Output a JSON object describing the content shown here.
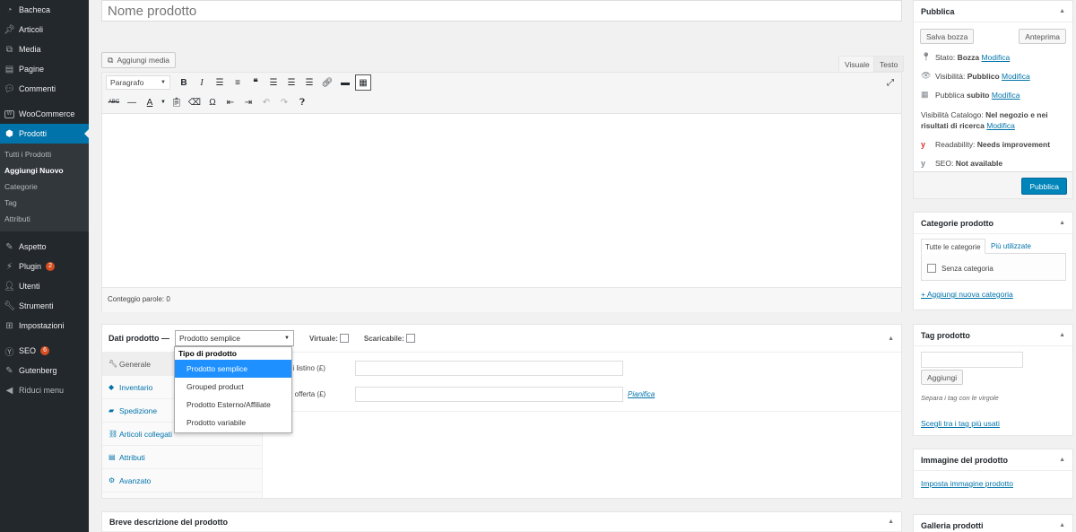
{
  "sidebar": {
    "items_top": [
      {
        "label": "Bacheca",
        "icon": "dashboard-icon"
      },
      {
        "label": "Articoli",
        "icon": "pin-icon"
      },
      {
        "label": "Media",
        "icon": "media-icon"
      },
      {
        "label": "Pagine",
        "icon": "page-icon"
      },
      {
        "label": "Commenti",
        "icon": "comment-icon"
      }
    ],
    "woocommerce": "WooCommerce",
    "prodotti": "Prodotti",
    "submenu": [
      "Tutti i Prodotti",
      "Aggiungi Nuovo",
      "Categorie",
      "Tag",
      "Attributi"
    ],
    "items_bottom": [
      {
        "label": "Aspetto",
        "icon": "brush-icon"
      },
      {
        "label": "Plugin",
        "icon": "plugin-icon",
        "badge": "2"
      },
      {
        "label": "Utenti",
        "icon": "user-icon"
      },
      {
        "label": "Strumenti",
        "icon": "wrench-icon"
      },
      {
        "label": "Impostazioni",
        "icon": "settings-icon"
      }
    ],
    "seo": {
      "label": "SEO",
      "badge": "6"
    },
    "gutenberg": "Gutenberg",
    "collapse": "Riduci menu"
  },
  "title": {
    "placeholder": "Nome prodotto"
  },
  "editor": {
    "add_media": "Aggiungi media",
    "tab_visual": "Visuale",
    "tab_text": "Testo",
    "format": "Paragrafo",
    "word_count": "Conteggio parole: 0"
  },
  "product_data": {
    "label": "Dati prodotto —",
    "type_selected": "Prodotto semplice",
    "virtual": "Virtuale:",
    "downloadable": "Scaricabile:",
    "dropdown_header": "Tipo di prodotto",
    "options": [
      "Prodotto semplice",
      "Grouped product",
      "Prodotto Esterno/Affiliate",
      "Prodotto variabile"
    ],
    "tabs": [
      "Generale",
      "Inventario",
      "Spedizione",
      "Articoli collegati",
      "Attributi",
      "Avanzato"
    ],
    "price_label": "di listino (£)",
    "sale_label": "n offerta (£)",
    "schedule": "Pianifica"
  },
  "short_desc": {
    "title": "Breve descrizione del prodotto"
  },
  "publish": {
    "title": "Pubblica",
    "save_draft": "Salva bozza",
    "preview": "Anteprima",
    "status_label": "Stato:",
    "status_value": "Bozza",
    "visibility_label": "Visibilità:",
    "visibility_value": "Pubblico",
    "publish_time_label": "Pubblica",
    "publish_time_value": "subito",
    "edit": "Modifica",
    "catalog_label": "Visibilità Catalogo:",
    "catalog_value": "Nel negozio e nei risultati di ricerca",
    "readability_label": "Readability:",
    "readability_value": "Needs improvement",
    "seo_label": "SEO:",
    "seo_value": "Not available",
    "publish_button": "Pubblica"
  },
  "categories": {
    "title": "Categorie prodotto",
    "tab_all": "Tutte le categorie",
    "tab_most": "Più utilizzate",
    "item": "Senza categoria",
    "add_new": "+ Aggiungi nuova categoria"
  },
  "tags": {
    "title": "Tag prodotto",
    "add": "Aggiungi",
    "hint": "Separa i tag con le virgole",
    "choose": "Scegli tra i tag più usati"
  },
  "image": {
    "title": "Immagine del prodotto",
    "set": "Imposta immagine prodotto"
  },
  "gallery": {
    "title": "Galleria prodotti"
  },
  "colors": {
    "sidebar": "#23282d",
    "active": "#0073aa",
    "link": "#0073aa",
    "primary": "#0085ba"
  }
}
